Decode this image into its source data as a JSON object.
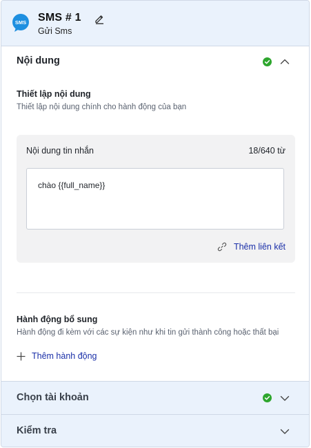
{
  "header": {
    "title": "SMS # 1",
    "subtitle": "Gửi Sms",
    "badge_text": "SMS",
    "icon": "sms-bubble-icon",
    "edit_icon": "pencil-icon"
  },
  "sections": {
    "content": {
      "title": "Nội dung",
      "status": "complete",
      "expanded": true,
      "setup_title": "Thiết lập nội dung",
      "setup_desc": "Thiết lập nội dung chính cho hành động của bạn",
      "message_label": "Nội dung tin nhắn",
      "char_count": "18/640 từ",
      "message_value": "chào {{full_name}}",
      "add_link_label": "Thêm liên kết",
      "extra_title": "Hành động bổ sung",
      "extra_desc": "Hành động đi kèm với các sự kiện như khi tin gửi thành công hoặc thất bại",
      "add_action_label": "Thêm hành động"
    },
    "account": {
      "title": "Chọn tài khoản",
      "status": "complete",
      "expanded": false
    },
    "review": {
      "title": "Kiểm tra",
      "expanded": false
    }
  },
  "colors": {
    "header_bg": "#eaf2fc",
    "badge_blue": "#1e8fe0",
    "success_green": "#2ea62e",
    "link_blue": "#1a2fa8"
  }
}
